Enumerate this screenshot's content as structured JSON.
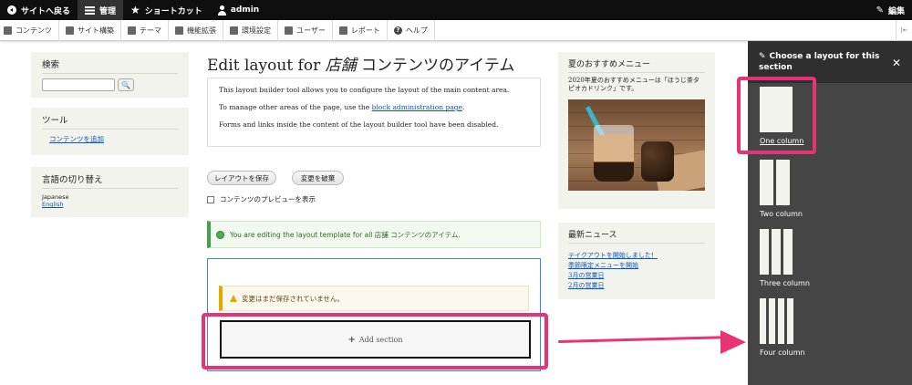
{
  "toolbar": {
    "back": "サイトへ戻る",
    "manage": "管理",
    "shortcuts": "ショートカット",
    "user": "admin",
    "edit": "編集"
  },
  "admin_menu": [
    {
      "label": "コンテンツ"
    },
    {
      "label": "サイト構築"
    },
    {
      "label": "テーマ"
    },
    {
      "label": "機能拡張"
    },
    {
      "label": "環境設定"
    },
    {
      "label": "ユーザー"
    },
    {
      "label": "レポート"
    },
    {
      "label": "ヘルプ"
    }
  ],
  "left_sidebar": {
    "search": {
      "title": "検索",
      "value": ""
    },
    "tools": {
      "title": "ツール",
      "link": "コンテンツを追加"
    },
    "language": {
      "title": "言語の切り替え",
      "options": [
        "Japanese",
        "English"
      ]
    }
  },
  "main": {
    "title_prefix": "Edit layout for",
    "title_emphasis": "店舗",
    "title_suffix": "コンテンツのアイテム",
    "info": {
      "p1": "This layout builder tool allows you to configure the layout of the main content area.",
      "p2_before": "To manage other areas of the page, use the",
      "p2_link": "block administration page",
      "p2_after": ".",
      "p3": "Forms and links inside the content of the layout builder tool have been disabled."
    },
    "save_button": "レイアウトを保存",
    "discard_button": "変更を破棄",
    "preview_label": "コンテンツのプレビューを表示",
    "status_message": "You are editing the layout template for all 店舗 コンテンツのアイテム.",
    "warning_message": "変更はまだ保存されていません。",
    "add_section": "Add section"
  },
  "right_sidebar": {
    "summer": {
      "title": "夏のおすすめメニュー",
      "text": "2020年夏のおすすめメニューは「ほうじ茶タピオカドリンク」です。"
    },
    "news": {
      "title": "最新ニュース",
      "items": [
        "テイクアウトを開始しました！",
        "季節限定メニューを開始",
        "3月の営業日",
        "2月の営業日"
      ]
    }
  },
  "layout_panel": {
    "title": "Choose a layout for this section",
    "layouts": [
      {
        "label": "One column",
        "columns": 1
      },
      {
        "label": "Two column",
        "columns": 2
      },
      {
        "label": "Three column",
        "columns": 3
      },
      {
        "label": "Four column",
        "columns": 4
      }
    ]
  },
  "colors": {
    "highlight": "#e93375",
    "link": "#0a57b3",
    "status_green": "#43a047",
    "warning": "#e0a800",
    "region_border": "#3b86d8"
  }
}
